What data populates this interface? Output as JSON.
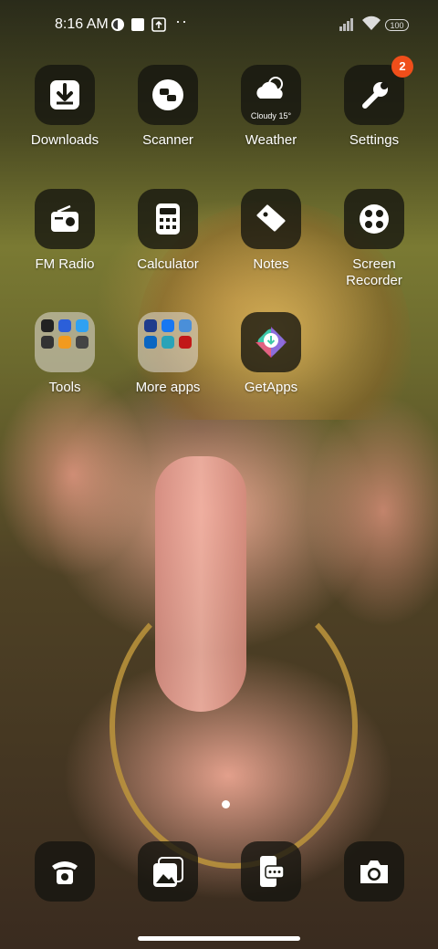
{
  "status_bar": {
    "time": "8:16 AM",
    "battery": "100",
    "icons": [
      "vpn-icon",
      "notification-square-icon",
      "upload-icon",
      "more-dots-icon",
      "signal-icon",
      "wifi-icon",
      "battery-icon"
    ]
  },
  "apps": {
    "downloads": {
      "label": "Downloads",
      "icon": "download-icon"
    },
    "scanner": {
      "label": "Scanner",
      "icon": "scanner-icon"
    },
    "weather": {
      "label": "Weather",
      "icon": "weather-cloud-icon",
      "tile_text": "Cloudy 15°"
    },
    "settings": {
      "label": "Settings",
      "icon": "wrench-icon",
      "badge": "2"
    },
    "fm_radio": {
      "label": "FM Radio",
      "icon": "radio-icon"
    },
    "calculator": {
      "label": "Calculator",
      "icon": "calculator-icon"
    },
    "notes": {
      "label": "Notes",
      "icon": "notes-icon"
    },
    "screen_recorder": {
      "label": "Screen\nRecorder",
      "label_line1": "Screen",
      "label_line2": "Recorder",
      "icon": "record-icon"
    },
    "tools": {
      "label": "Tools",
      "icon": "folder-icon"
    },
    "more_apps": {
      "label": "More apps",
      "icon": "folder-icon"
    },
    "getapps": {
      "label": "GetApps",
      "icon": "getapps-icon"
    }
  },
  "dock": {
    "phone": {
      "icon": "phone-icon"
    },
    "gallery": {
      "icon": "gallery-icon"
    },
    "messages": {
      "icon": "messages-icon"
    },
    "camera": {
      "icon": "camera-icon"
    }
  },
  "colors": {
    "badge": "#f04e1a",
    "tile_bg": "#1a1a12",
    "getapps_accent": "#3cc8a8"
  },
  "pager": {
    "current_page": 1,
    "total_pages": 1
  }
}
